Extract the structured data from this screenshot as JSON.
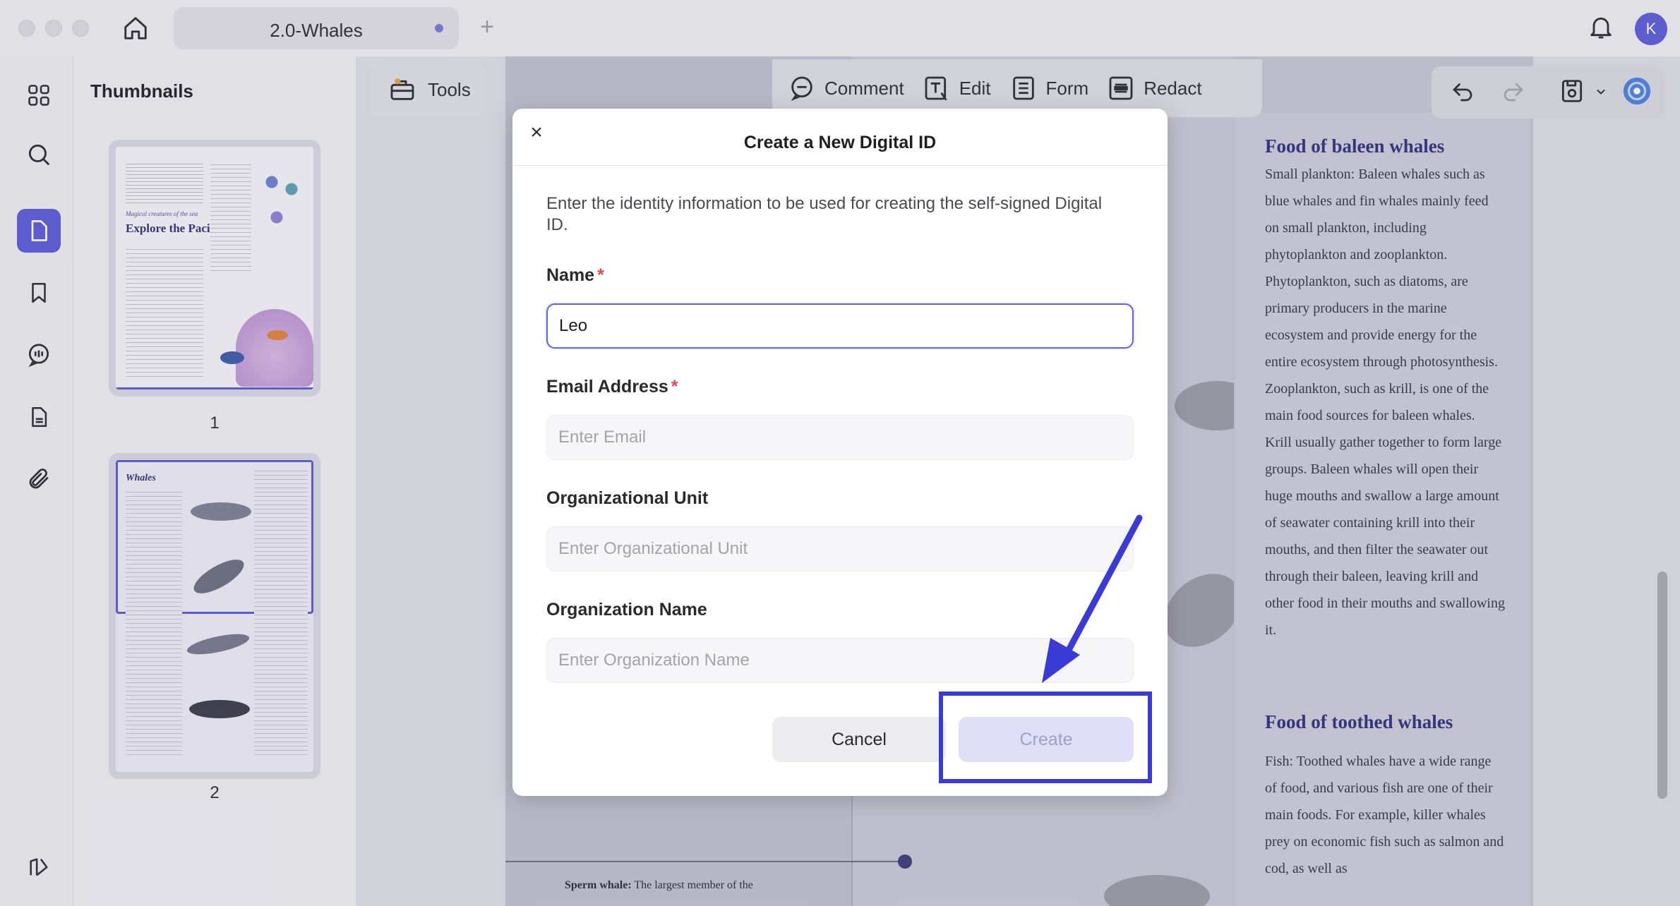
{
  "titlebar": {
    "tab_title": "2.0-Whales",
    "new_tab_glyph": "+",
    "avatar_initial": "K"
  },
  "thumbnails": {
    "title": "Thumbnails",
    "pages": [
      {
        "number": "1",
        "heading_small": "Magical creatures of the sea",
        "heading": "Explore the Pacific"
      },
      {
        "number": "2",
        "heading": "Whales"
      }
    ]
  },
  "toolbar": {
    "tools_label": "Tools",
    "modes": [
      {
        "label": "Comment",
        "icon": "comment-icon"
      },
      {
        "label": "Edit",
        "icon": "edit-text-icon"
      },
      {
        "label": "Form",
        "icon": "form-icon"
      },
      {
        "label": "Redact",
        "icon": "redact-icon"
      }
    ]
  },
  "document": {
    "section1_heading": "Food of baleen whales",
    "section1_text": "Small plankton: Baleen whales such as blue whales and fin whales mainly feed on small plankton, including phytoplankton and zooplankton. Phytoplankton, such as diatoms, are primary producers in the marine ecosystem and provide energy for the entire ecosystem through photosynthesis. Zooplankton, such as krill, is one of the main food sources for baleen whales. Krill usually gather together to form large groups. Baleen whales will open their huge mouths and swallow a large amount of seawater containing krill into their mouths, and then filter the seawater out through their baleen, leaving krill and other food in their mouths and swallowing it.",
    "section2_heading": "Food of toothed whales",
    "section2_text": "Fish: Toothed whales have a wide range of food, and various fish are one of their main foods. For example, killer whales prey on economic fish such as salmon and cod, as well as",
    "caption_bold": "Sperm whale:",
    "caption_rest": " The largest member of the"
  },
  "dialog": {
    "close_glyph": "×",
    "title": "Create a New Digital ID",
    "description": "Enter the identity information to be used for creating the self-signed Digital ID.",
    "name_label": "Name",
    "name_value": "Leo",
    "email_label": "Email Address",
    "email_placeholder": "Enter Email",
    "org_unit_label": "Organizational Unit",
    "org_unit_placeholder": "Enter Organizational Unit",
    "org_name_label": "Organization Name",
    "org_name_placeholder": "Enter Organization Name",
    "required_mark": "*",
    "cancel_label": "Cancel",
    "create_label": "Create"
  },
  "colors": {
    "accent": "#5a5ad6",
    "annotation": "#3a3ad6",
    "heading_blue": "#2d2e7a"
  }
}
